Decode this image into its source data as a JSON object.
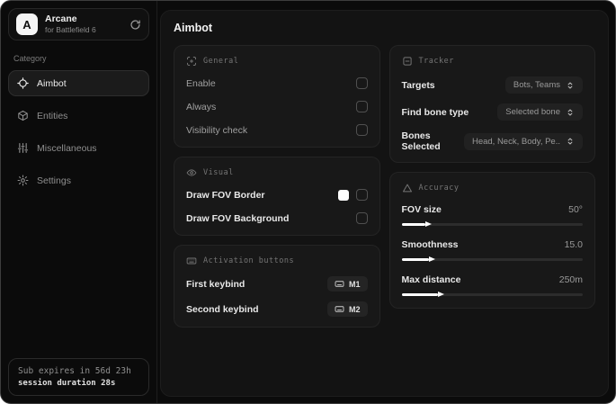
{
  "sidebar": {
    "logo_letter": "A",
    "app_name": "Arcane",
    "app_subtitle": "for Battlefield 6",
    "category_label": "Category",
    "items": [
      {
        "label": "Aimbot",
        "icon": "crosshair-icon",
        "active": true
      },
      {
        "label": "Entities",
        "icon": "cube-icon",
        "active": false
      },
      {
        "label": "Miscellaneous",
        "icon": "sliders-icon",
        "active": false
      },
      {
        "label": "Settings",
        "icon": "gear-icon",
        "active": false
      }
    ],
    "footer": {
      "sub_expiry": "Sub expires in 56d 23h",
      "session_duration": "session duration 28s"
    }
  },
  "main": {
    "title": "Aimbot",
    "general": {
      "title": "General",
      "icon": "scan-icon",
      "rows": [
        {
          "label": "Enable",
          "control": "checkbox",
          "checked": false
        },
        {
          "label": "Always",
          "control": "checkbox",
          "checked": false
        },
        {
          "label": "Visibility check",
          "control": "checkbox",
          "checked": false
        }
      ]
    },
    "visual": {
      "title": "Visual",
      "icon": "eye-icon",
      "rows": [
        {
          "label": "Draw FOV Border",
          "control": "color-and-checkbox",
          "swatch_color": "#ffffff",
          "checked": false
        },
        {
          "label": "Draw FOV Background",
          "control": "checkbox",
          "checked": false
        }
      ]
    },
    "activation": {
      "title": "Activation buttons",
      "icon": "keyboard-icon",
      "rows": [
        {
          "label": "First keybind",
          "keybind": "M1"
        },
        {
          "label": "Second keybind",
          "keybind": "M2"
        }
      ]
    },
    "tracker": {
      "title": "Tracker",
      "icon": "frame-minus-icon",
      "rows": [
        {
          "label": "Targets",
          "value": "Bots, Teams"
        },
        {
          "label": "Find bone type",
          "value": "Selected bone"
        },
        {
          "label": "Bones Selected",
          "value": "Head, Neck, Body, Pe.."
        }
      ]
    },
    "accuracy": {
      "title": "Accuracy",
      "icon": "triangle-icon",
      "rows": [
        {
          "label": "FOV size",
          "value": "50°",
          "fill_pct": 13
        },
        {
          "label": "Smoothness",
          "value": "15.0",
          "fill_pct": 15
        },
        {
          "label": "Max distance",
          "value": "250m",
          "fill_pct": 20
        }
      ]
    }
  },
  "colors": {
    "accent": "#ffffff",
    "window_bg": "#0b0b0b",
    "panel_bg": "#131313",
    "card_bg": "#181818"
  }
}
